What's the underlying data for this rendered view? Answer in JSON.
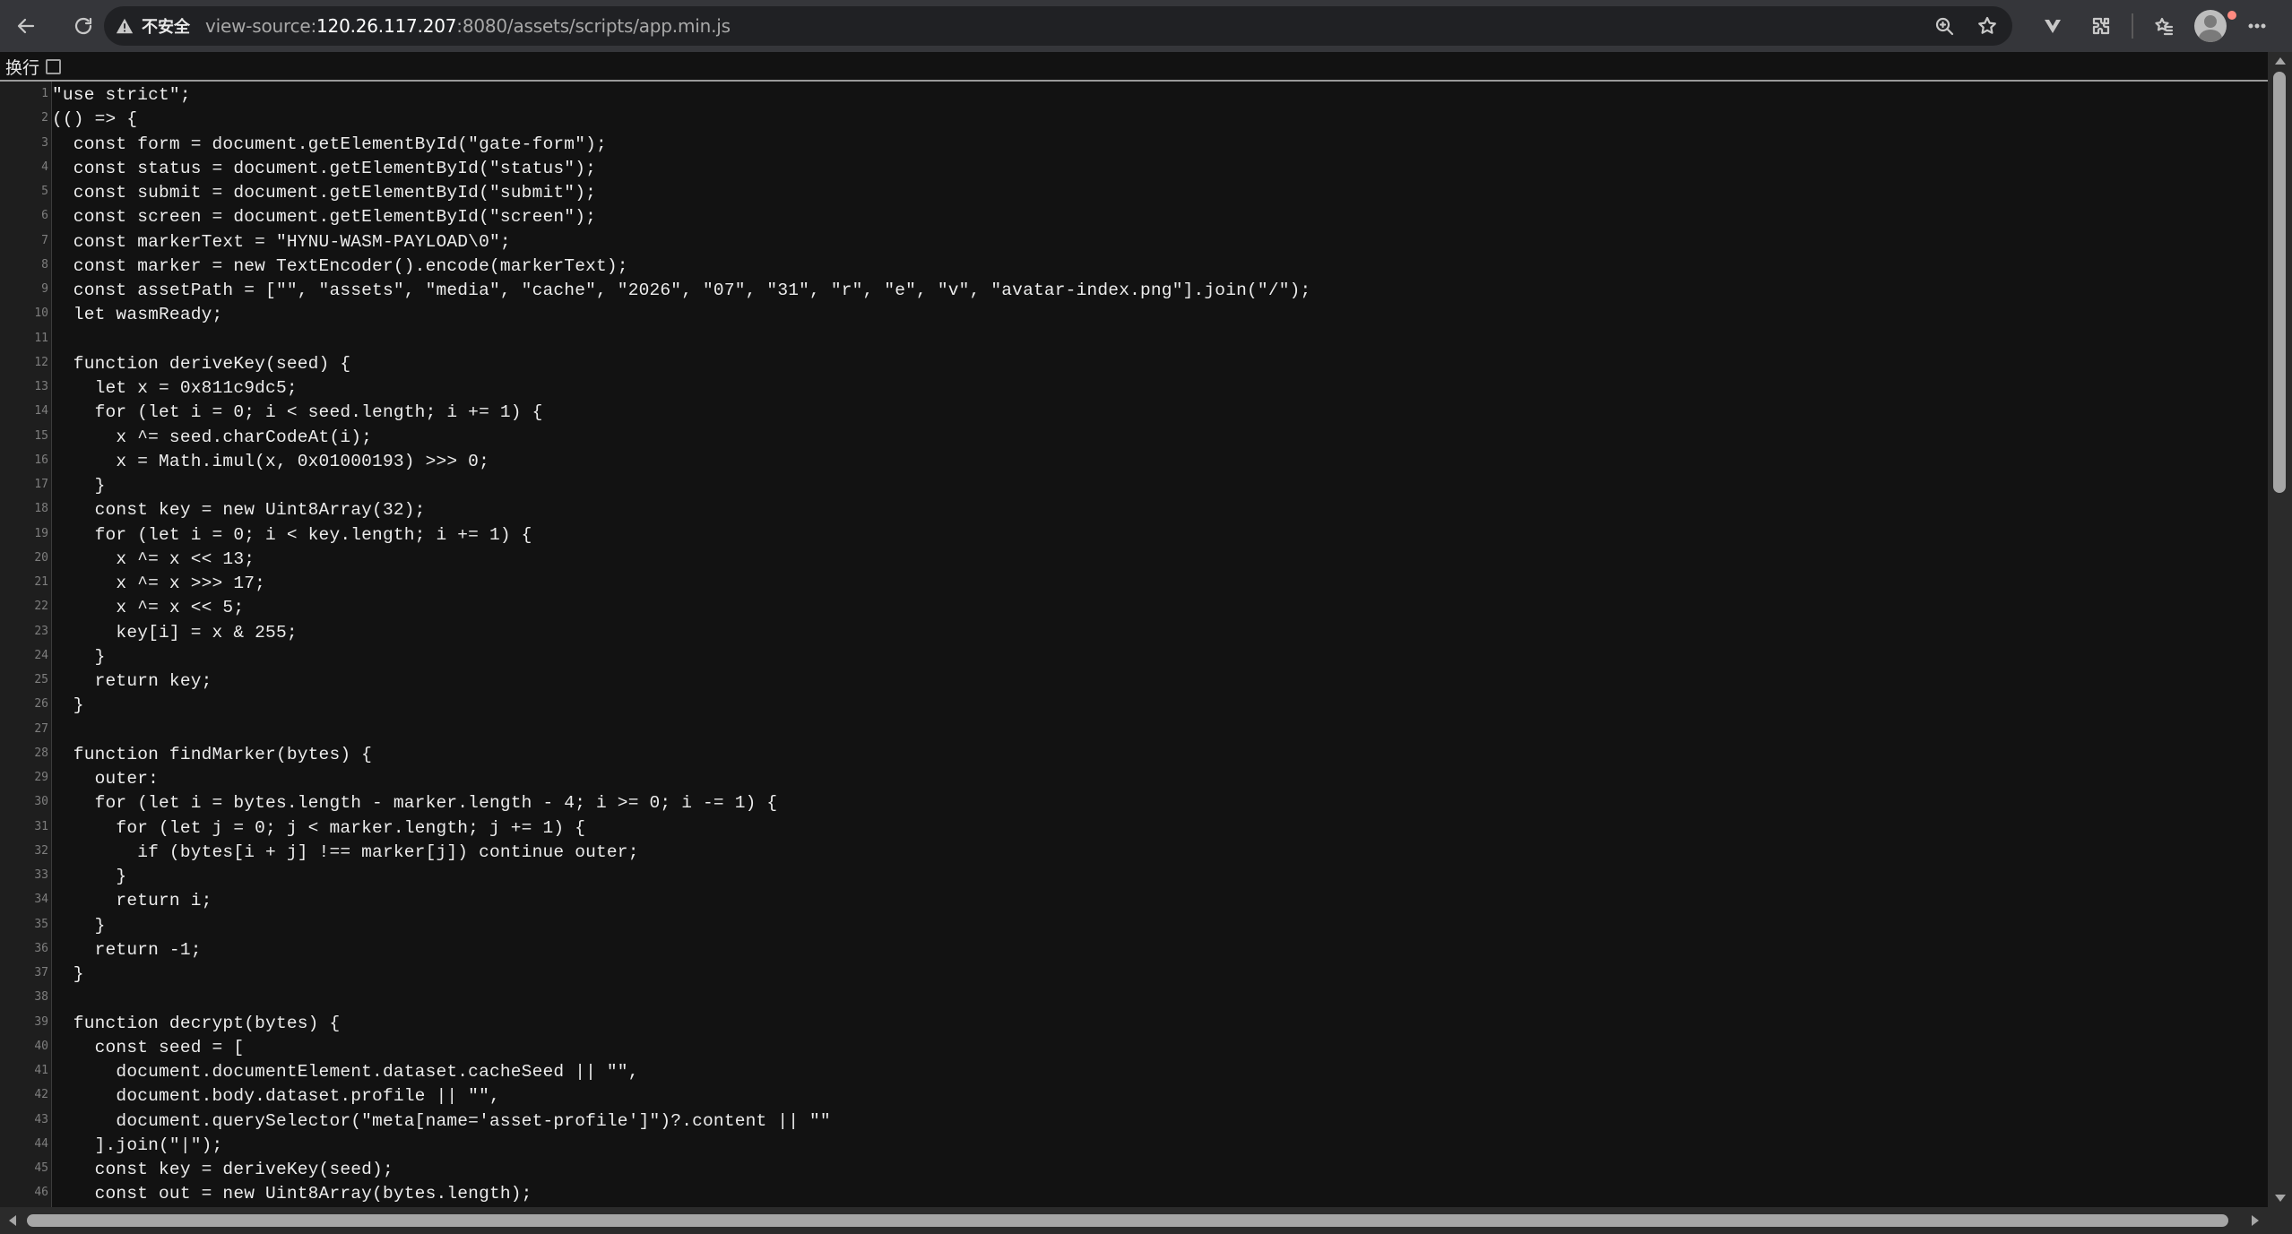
{
  "browser": {
    "security_label": "不安全",
    "url": {
      "prefix": "view-source:",
      "host": "120.26.117.207",
      "rest": ":8080/assets/scripts/app.min.js"
    },
    "icons": [
      "back-arrow-icon",
      "reload-icon",
      "warning-icon",
      "zoom-icon",
      "bookmark-star-icon",
      "vue-devtools-icon",
      "extensions-icon",
      "favorites-icon",
      "profile-avatar",
      "more-icon"
    ]
  },
  "wrap_toggle": {
    "label": "换行",
    "checked": false
  },
  "source_lines": [
    {
      "n": "1",
      "code": "\"use strict\";"
    },
    {
      "n": "2",
      "code": "(() => {"
    },
    {
      "n": "3",
      "code": "  const form = document.getElementById(\"gate-form\");"
    },
    {
      "n": "4",
      "code": "  const status = document.getElementById(\"status\");"
    },
    {
      "n": "5",
      "code": "  const submit = document.getElementById(\"submit\");"
    },
    {
      "n": "6",
      "code": "  const screen = document.getElementById(\"screen\");"
    },
    {
      "n": "7",
      "code": "  const markerText = \"HYNU-WASM-PAYLOAD\\0\";"
    },
    {
      "n": "8",
      "code": "  const marker = new TextEncoder().encode(markerText);"
    },
    {
      "n": "9",
      "code": "  const assetPath = [\"\", \"assets\", \"media\", \"cache\", \"2026\", \"07\", \"31\", \"r\", \"e\", \"v\", \"avatar-index.png\"].join(\"/\");"
    },
    {
      "n": "10",
      "code": "  let wasmReady;"
    },
    {
      "n": "11",
      "code": ""
    },
    {
      "n": "12",
      "code": "  function deriveKey(seed) {"
    },
    {
      "n": "13",
      "code": "    let x = 0x811c9dc5;"
    },
    {
      "n": "14",
      "code": "    for (let i = 0; i < seed.length; i += 1) {"
    },
    {
      "n": "15",
      "code": "      x ^= seed.charCodeAt(i);"
    },
    {
      "n": "16",
      "code": "      x = Math.imul(x, 0x01000193) >>> 0;"
    },
    {
      "n": "17",
      "code": "    }"
    },
    {
      "n": "18",
      "code": "    const key = new Uint8Array(32);"
    },
    {
      "n": "19",
      "code": "    for (let i = 0; i < key.length; i += 1) {"
    },
    {
      "n": "20",
      "code": "      x ^= x << 13;"
    },
    {
      "n": "21",
      "code": "      x ^= x >>> 17;"
    },
    {
      "n": "22",
      "code": "      x ^= x << 5;"
    },
    {
      "n": "23",
      "code": "      key[i] = x & 255;"
    },
    {
      "n": "24",
      "code": "    }"
    },
    {
      "n": "25",
      "code": "    return key;"
    },
    {
      "n": "26",
      "code": "  }"
    },
    {
      "n": "27",
      "code": ""
    },
    {
      "n": "28",
      "code": "  function findMarker(bytes) {"
    },
    {
      "n": "29",
      "code": "    outer:"
    },
    {
      "n": "30",
      "code": "    for (let i = bytes.length - marker.length - 4; i >= 0; i -= 1) {"
    },
    {
      "n": "31",
      "code": "      for (let j = 0; j < marker.length; j += 1) {"
    },
    {
      "n": "32",
      "code": "        if (bytes[i + j] !== marker[j]) continue outer;"
    },
    {
      "n": "33",
      "code": "      }"
    },
    {
      "n": "34",
      "code": "      return i;"
    },
    {
      "n": "35",
      "code": "    }"
    },
    {
      "n": "36",
      "code": "    return -1;"
    },
    {
      "n": "37",
      "code": "  }"
    },
    {
      "n": "38",
      "code": ""
    },
    {
      "n": "39",
      "code": "  function decrypt(bytes) {"
    },
    {
      "n": "40",
      "code": "    const seed = ["
    },
    {
      "n": "41",
      "code": "      document.documentElement.dataset.cacheSeed || \"\","
    },
    {
      "n": "42",
      "code": "      document.body.dataset.profile || \"\","
    },
    {
      "n": "43",
      "code": "      document.querySelector(\"meta[name='asset-profile']\")?.content || \"\""
    },
    {
      "n": "44",
      "code": "    ].join(\"|\");"
    },
    {
      "n": "45",
      "code": "    const key = deriveKey(seed);"
    },
    {
      "n": "46",
      "code": "    const out = new Uint8Array(bytes.length);"
    }
  ]
}
